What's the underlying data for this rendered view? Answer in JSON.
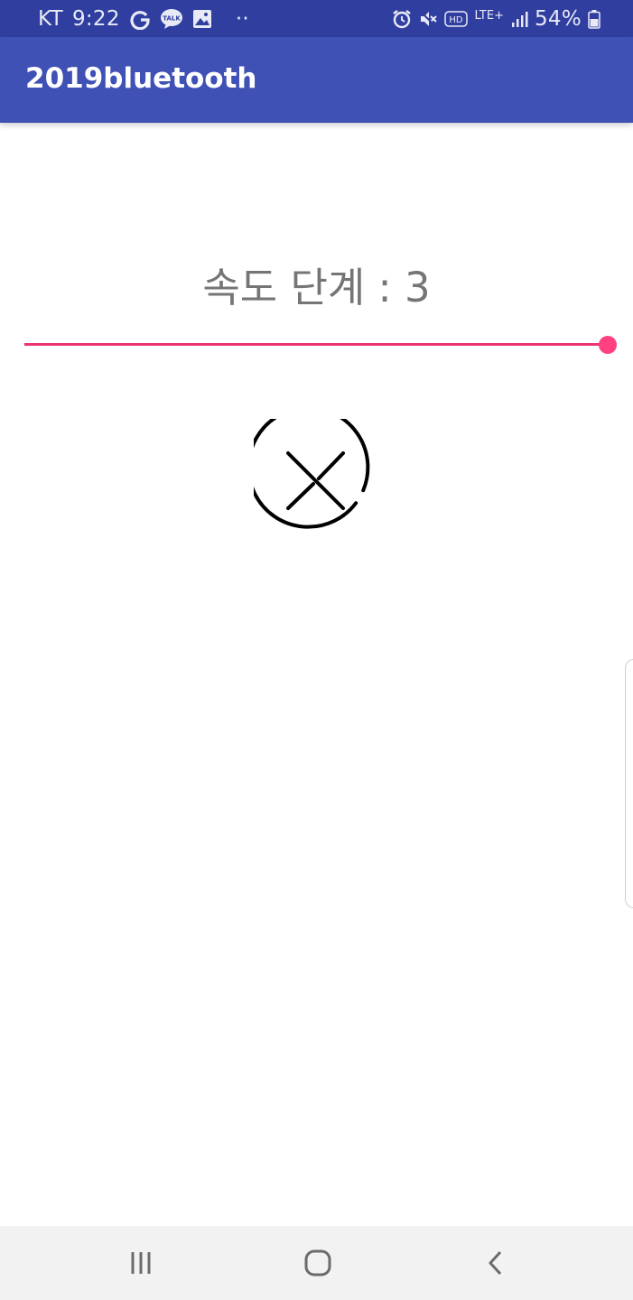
{
  "status_bar": {
    "carrier": "KT",
    "time": "9:22",
    "network_type": "LTE+",
    "hd_badge": "HD",
    "battery_percent": "54%",
    "talk_badge": "TALK",
    "dots": "··",
    "background_color": "#303f9f",
    "icons": [
      "google-icon",
      "kakaotalk-icon",
      "gallery-icon",
      "alarm-icon",
      "mute-icon",
      "signal-icon",
      "battery-icon"
    ]
  },
  "app_bar": {
    "title": "2019bluetooth",
    "background_color": "#3f51b5"
  },
  "main": {
    "speed_label": "속도 단계 : 3",
    "seekbar": {
      "value": 3,
      "max": 3,
      "accent_color": "#ff4081"
    },
    "disconnect_icon": "close-circle-icon"
  },
  "nav_bar": {
    "icons": [
      "recent-apps-icon",
      "home-icon",
      "back-icon"
    ],
    "background_color": "#f2f2f2"
  }
}
